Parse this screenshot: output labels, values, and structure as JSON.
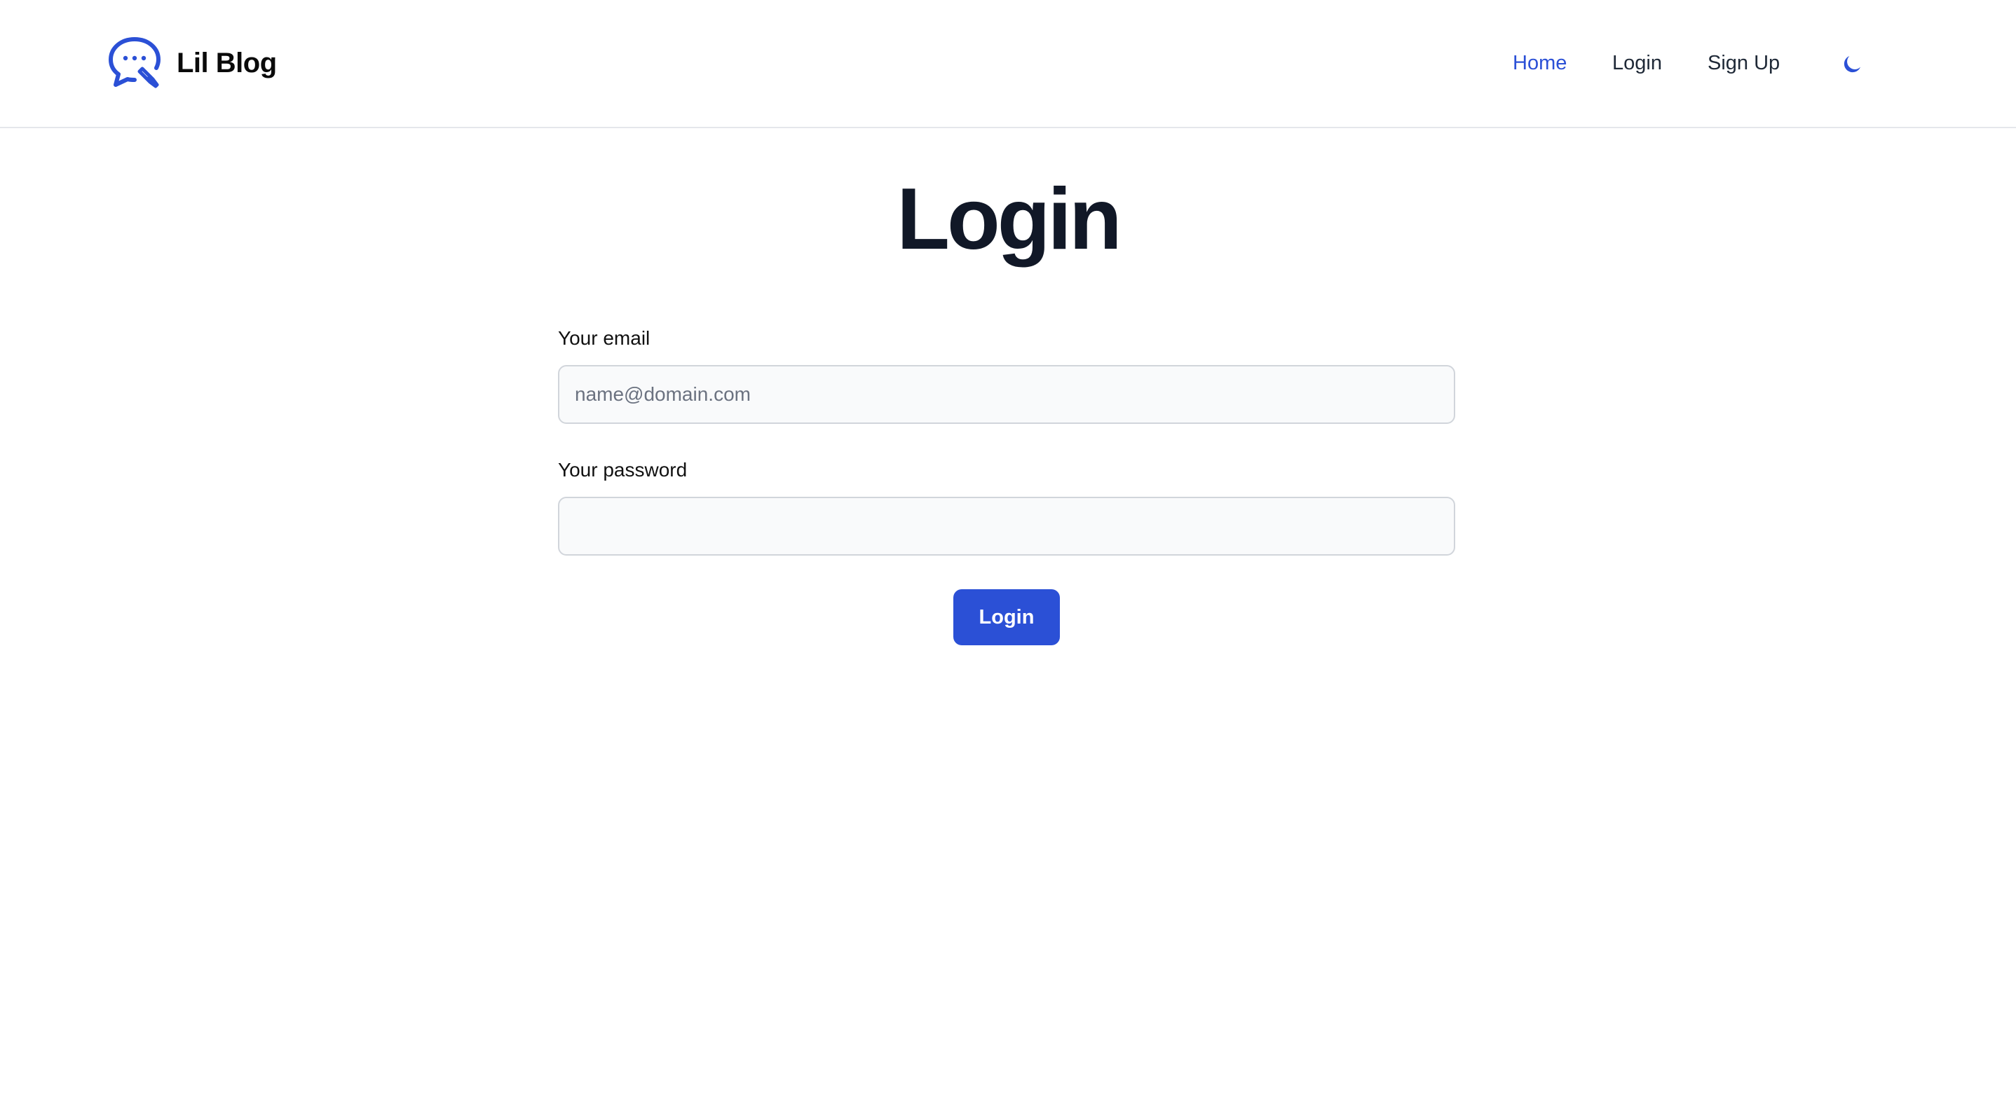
{
  "header": {
    "brand_name": "Lil Blog",
    "logo_icon": "chat-bubble-pencil-icon",
    "nav": [
      {
        "label": "Home",
        "active": true
      },
      {
        "label": "Login",
        "active": false
      },
      {
        "label": "Sign Up",
        "active": false
      }
    ],
    "theme_toggle_icon": "moon-icon"
  },
  "main": {
    "title": "Login",
    "email": {
      "label": "Your email",
      "placeholder": "name@domain.com",
      "value": ""
    },
    "password": {
      "label": "Your password",
      "placeholder": "",
      "value": ""
    },
    "submit_label": "Login"
  },
  "colors": {
    "accent": "#2b50d6",
    "title": "#111827",
    "input_bg": "#f9fafb",
    "input_border": "#d1d5db",
    "header_border": "#e5e7eb"
  }
}
